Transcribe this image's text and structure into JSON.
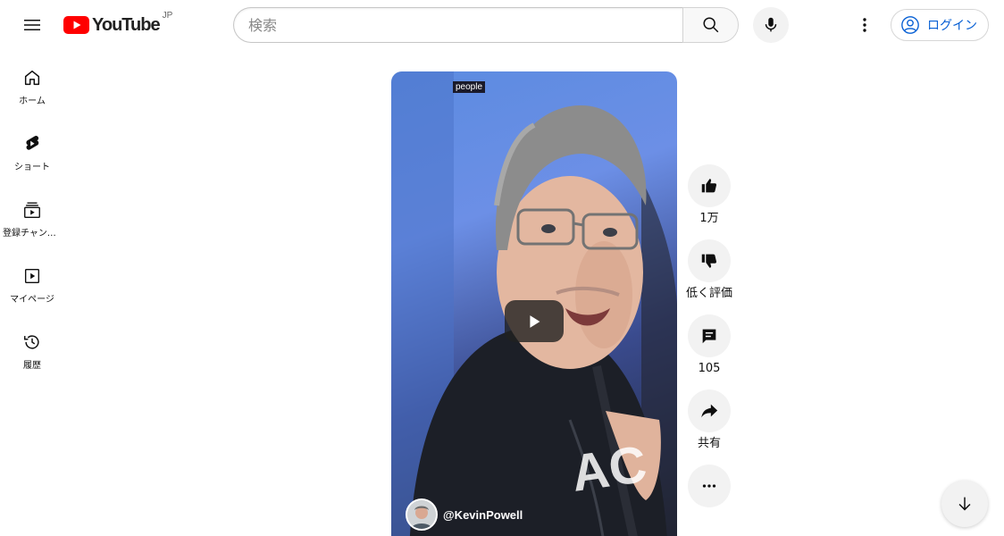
{
  "header": {
    "logo_text": "YouTube",
    "region": "JP",
    "search_placeholder": "検索",
    "search_value": "",
    "login_label": "ログイン"
  },
  "sidebar": {
    "items": [
      {
        "label": "ホーム",
        "icon": "home-icon"
      },
      {
        "label": "ショート",
        "icon": "shorts-icon"
      },
      {
        "label": "登録チャンネル",
        "icon": "subscriptions-icon"
      },
      {
        "label": "マイページ",
        "icon": "library-icon"
      },
      {
        "label": "履歴",
        "icon": "history-icon"
      }
    ]
  },
  "short": {
    "overlay_tag": "people",
    "channel_handle": "@KevinPowell"
  },
  "actions": {
    "like_count": "1万",
    "dislike_label": "低く評価",
    "comment_count": "105",
    "share_label": "共有"
  },
  "colors": {
    "brand_red": "#ff0000",
    "link_blue": "#065fd4",
    "button_gray": "#f2f2f2"
  }
}
